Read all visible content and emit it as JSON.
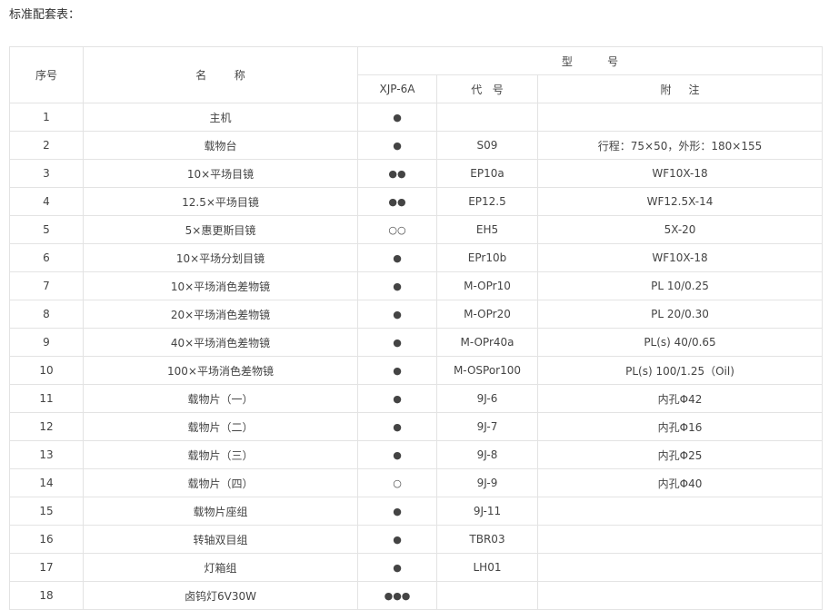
{
  "heading": "标准配套表：",
  "table": {
    "headers": {
      "seq": "序号",
      "name": "名        称",
      "model_group": "型          号",
      "model": "XJP-6A",
      "code": "代   号",
      "note": "附     注"
    },
    "rows": [
      {
        "seq": "1",
        "name": "主机",
        "mark": "●",
        "code": "",
        "note": ""
      },
      {
        "seq": "2",
        "name": "载物台",
        "mark": "●",
        "code": "S09",
        "note": "行程：75×50，外形：180×155"
      },
      {
        "seq": "3",
        "name": "10×平场目镜",
        "mark": "●●",
        "code": "EP10a",
        "note": "WF10X-18"
      },
      {
        "seq": "4",
        "name": "12.5×平场目镜",
        "mark": "●●",
        "code": "EP12.5",
        "note": "WF12.5X-14"
      },
      {
        "seq": "5",
        "name": "5×惠更斯目镜",
        "mark": "○○",
        "code": "EH5",
        "note": "5X-20"
      },
      {
        "seq": "6",
        "name": "10×平场分划目镜",
        "mark": "●",
        "code": "EPr10b",
        "note": "WF10X-18"
      },
      {
        "seq": "7",
        "name": "10×平场消色差物镜",
        "mark": "●",
        "code": "M-OPr10",
        "note": "PL 10/0.25"
      },
      {
        "seq": "8",
        "name": "20×平场消色差物镜",
        "mark": "●",
        "code": "M-OPr20",
        "note": "PL 20/0.30"
      },
      {
        "seq": "9",
        "name": "40×平场消色差物镜",
        "mark": "●",
        "code": "M-OPr40a",
        "note": "PL(s) 40/0.65"
      },
      {
        "seq": "10",
        "name": "100×平场消色差物镜",
        "mark": "●",
        "code": "M-OSPor100",
        "note": "PL(s) 100/1.25（Oil)"
      },
      {
        "seq": "11",
        "name": "载物片（一）",
        "mark": "●",
        "code": "9J-6",
        "note": "内孔Φ42"
      },
      {
        "seq": "12",
        "name": "载物片（二）",
        "mark": "●",
        "code": "9J-7",
        "note": "内孔Φ16"
      },
      {
        "seq": "13",
        "name": "载物片（三）",
        "mark": "●",
        "code": "9J-8",
        "note": "内孔Φ25"
      },
      {
        "seq": "14",
        "name": "载物片（四）",
        "mark": "○",
        "code": "9J-9",
        "note": "内孔Φ40"
      },
      {
        "seq": "15",
        "name": "载物片座组",
        "mark": "●",
        "code": "9J-11",
        "note": ""
      },
      {
        "seq": "16",
        "name": "转轴双目组",
        "mark": "●",
        "code": "TBR03",
        "note": ""
      },
      {
        "seq": "17",
        "name": "灯箱组",
        "mark": "●",
        "code": "LH01",
        "note": ""
      },
      {
        "seq": "18",
        "name": "卤钨灯6V30W",
        "mark": "●●●",
        "code": "",
        "note": ""
      }
    ]
  }
}
